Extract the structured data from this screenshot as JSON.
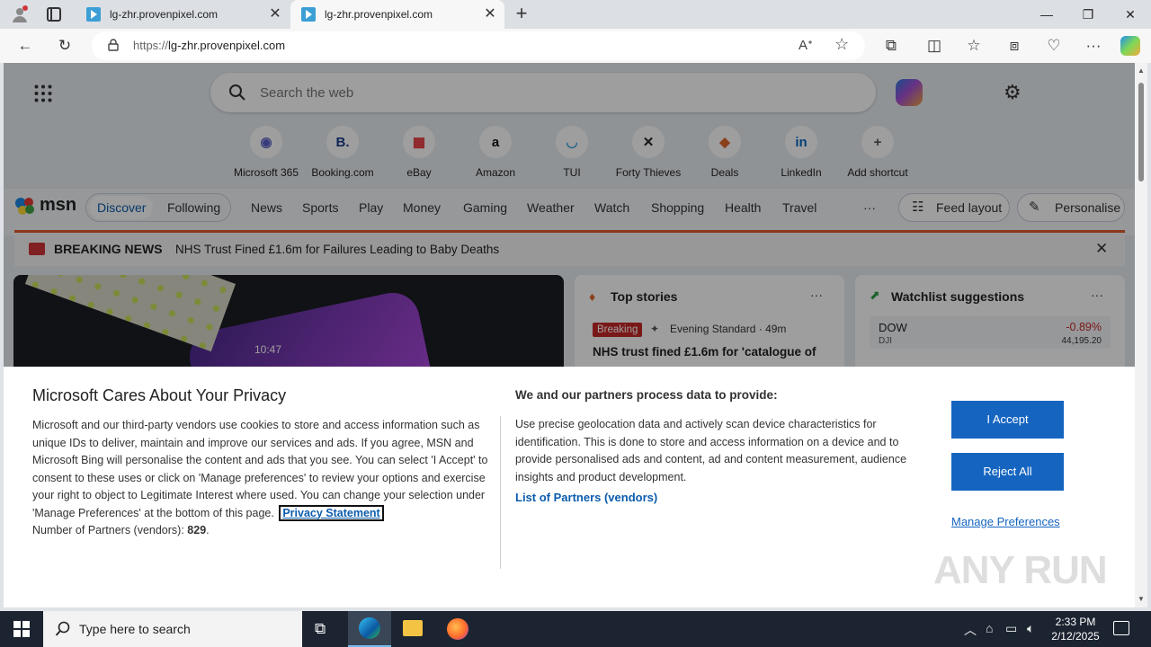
{
  "browser": {
    "tabs": [
      {
        "title": "lg-zhr.provenpixel.com",
        "active": false
      },
      {
        "title": "lg-zhr.provenpixel.com",
        "active": true
      }
    ],
    "new_tab": "+",
    "url_scheme": "https://",
    "url_host": "lg-zhr.provenpixel.com"
  },
  "msn": {
    "search_placeholder": "Search the web",
    "shortcuts": [
      {
        "label": "Microsoft 365",
        "icon": "microsoft-365-icon",
        "glyph": "◉",
        "color": "#5b5fc7"
      },
      {
        "label": "Booking.com",
        "icon": "booking-icon",
        "glyph": "B.",
        "color": "#1a3d8f"
      },
      {
        "label": "eBay",
        "icon": "ebay-icon",
        "glyph": "▦",
        "color": "#e53238"
      },
      {
        "label": "Amazon",
        "icon": "amazon-icon",
        "glyph": "a",
        "color": "#111111"
      },
      {
        "label": "TUI",
        "icon": "tui-icon",
        "glyph": "◡",
        "color": "#3aa0e0"
      },
      {
        "label": "Forty Thieves",
        "icon": "forty-thieves-icon",
        "glyph": "✕",
        "color": "#222222"
      },
      {
        "label": "Deals",
        "icon": "deals-icon",
        "glyph": "◆",
        "color": "#e0672a"
      },
      {
        "label": "LinkedIn",
        "icon": "linkedin-icon",
        "glyph": "in",
        "color": "#0a66c2"
      },
      {
        "label": "Add shortcut",
        "icon": "plus-icon",
        "glyph": "+",
        "color": "#555555"
      }
    ],
    "logo": "msn",
    "discover": "Discover",
    "following": "Following",
    "nav": [
      "News",
      "Sports",
      "Play",
      "Money",
      "Gaming",
      "Weather",
      "Watch",
      "Shopping",
      "Health",
      "Travel"
    ],
    "more": "···",
    "feed_layout": "Feed layout",
    "personalise": "Personalise",
    "breaking_label": "BREAKING NEWS",
    "breaking_text": "NHS Trust Fined £1.6m for Failures Leading to Baby Deaths",
    "top_stories": {
      "title": "Top stories",
      "badge": "Breaking",
      "source": "Evening Standard · 49m",
      "headline": "NHS trust fined £1.6m for 'catalogue of"
    },
    "watchlist": {
      "title": "Watchlist suggestions",
      "symbol": "DOW",
      "sub": "DJI",
      "change": "-0.89%",
      "value": "44,195.20"
    },
    "phone_time": "10:47"
  },
  "privacy": {
    "title": "Microsoft Cares About Your Privacy",
    "body": "Microsoft and our third-party vendors use cookies to store and access information such as unique IDs to deliver, maintain and improve our services and ads. If you agree, MSN and Microsoft Bing will personalise the content and ads that you see. You can select 'I Accept' to consent to these uses or click on 'Manage preferences' to review your options and exercise your right to object to Legitimate Interest where used.  You can change your selection under 'Manage Preferences' at the bottom of this page.",
    "privacy_link": "Privacy Statement",
    "partners_label": "Number of Partners (vendors):",
    "partners_count": "829",
    "partners_end": ".",
    "right_title": "We and our partners process data to provide:",
    "right_body": "Use precise geolocation data and actively scan device characteristics for identification. This is done to store and access information on a device and to provide personalised ads and content, ad and content measurement, audience insights and product development.",
    "vendors_link": "List of Partners (vendors)",
    "accept": "I Accept",
    "reject": "Reject All",
    "manage": "Manage Preferences"
  },
  "watermark": "ANY RUN",
  "taskbar": {
    "search_placeholder": "Type here to search",
    "time": "2:33 PM",
    "date": "2/12/2025"
  }
}
